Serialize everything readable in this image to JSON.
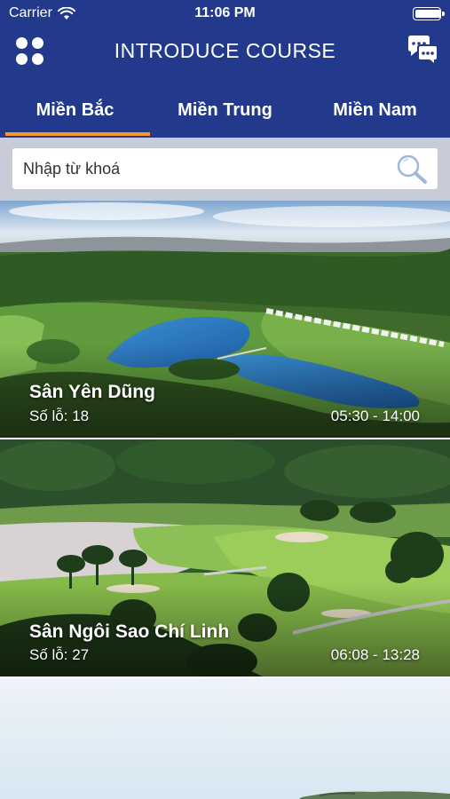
{
  "status_bar": {
    "carrier": "Carrier",
    "time": "11:06 PM",
    "battery_level": 0.95
  },
  "nav": {
    "title": "INTRODUCE COURSE",
    "menu_icon": "grid-dots-icon",
    "chat_icon": "chat-bubbles-icon"
  },
  "tabs": [
    {
      "label": "Miền Bắc",
      "active": true
    },
    {
      "label": "Miền Trung",
      "active": false
    },
    {
      "label": "Miền Nam",
      "active": false
    }
  ],
  "search": {
    "placeholder": "Nhập từ khoá",
    "value": ""
  },
  "courses": [
    {
      "name": "Sân Yên Dũng",
      "holes_label": "Số lỗ: 18",
      "hours": "05:30 - 14:00"
    },
    {
      "name": "Sân Ngôi Sao Chí Linh",
      "holes_label": "Số lỗ: 27",
      "hours": "06:08 - 13:28"
    }
  ],
  "colors": {
    "header": "#233a8c",
    "tab_indicator": "#f39a2b",
    "search_bg": "#c7ccd8"
  }
}
